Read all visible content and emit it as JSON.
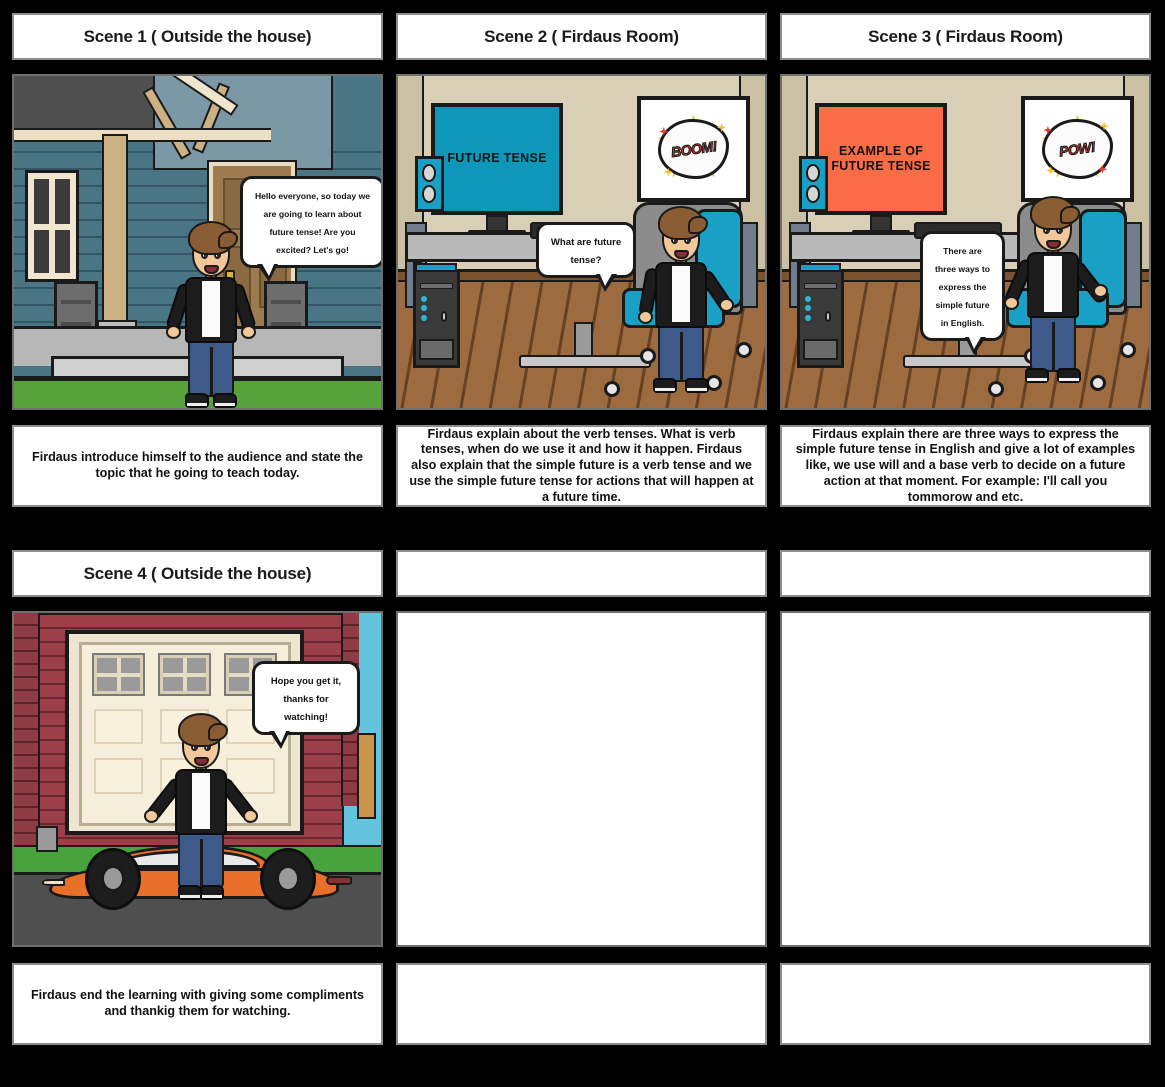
{
  "storyboard": {
    "rows": [
      {
        "cells": [
          {
            "title": "Scene 1 ( Outside the house)",
            "scene_type": "house-exterior",
            "caption": "Firdaus introduce himself to the audience and state the topic that he going to teach today.",
            "bubbles": [
              {
                "text": "Hello everyone, so today we are going to learn about future tense! Are you excited? Let's go!"
              }
            ],
            "screen_text": "",
            "burst_word": ""
          },
          {
            "title": "Scene 2 ( Firdaus Room)",
            "scene_type": "firdaus-room",
            "caption": "Firdaus explain about the verb tenses. What is verb tenses, when do we use it and how it happen. Firdaus also explain that the simple future is a verb tense and we use the simple future tense for actions that will happen at a future time.",
            "bubbles": [
              {
                "text": "What are future tense?"
              }
            ],
            "screen_text": "FUTURE TENSE",
            "screen_color": "#0f97ba",
            "burst_word": "BOOM!"
          },
          {
            "title": "Scene 3 ( Firdaus Room)",
            "scene_type": "firdaus-room",
            "caption": "Firdaus explain there are three ways to express the simple future tense in English and give a lot of examples like, we use will and a base verb to decide on a future action at that moment. For example: I'll call you tommorow and etc.",
            "bubbles": [
              {
                "text": "There are three ways to express the simple future in English."
              }
            ],
            "screen_text": "EXAMPLE OF FUTURE TENSE",
            "screen_color": "#fa6c45",
            "burst_word": "POW!"
          }
        ]
      },
      {
        "cells": [
          {
            "title": "Scene 4 ( Outside the house)",
            "scene_type": "garage-car",
            "caption": "Firdaus end the learning with giving some compliments and thankig them for watching.",
            "bubbles": [
              {
                "text": "Hope you get it, thanks for watching!"
              }
            ],
            "screen_text": "",
            "burst_word": ""
          },
          {
            "title": "",
            "scene_type": "empty",
            "caption": "",
            "bubbles": [],
            "screen_text": "",
            "burst_word": ""
          },
          {
            "title": "",
            "scene_type": "empty",
            "caption": "",
            "bubbles": [],
            "screen_text": "",
            "burst_word": ""
          }
        ]
      }
    ]
  },
  "colors": {
    "background": "#000000",
    "cell_background": "#ffffff",
    "cell_border": "#8d8d8d",
    "panel_border": "#6f6f6f",
    "text": "#111111",
    "house_siding": "#4a7585",
    "house_trim": "#ecdfc4",
    "room_wall": "#d9cfb7",
    "room_floor": "#9c6b3f",
    "monitor_blue": "#0f97ba",
    "monitor_orange": "#fa6c45",
    "brick_red": "#9c3f49",
    "car_orange": "#e8702a",
    "sky_blue": "#62c5dd",
    "grass_green": "#49a33c",
    "driveway_grey": "#4f4f4f",
    "chair_teal": "#1aa0c4"
  }
}
